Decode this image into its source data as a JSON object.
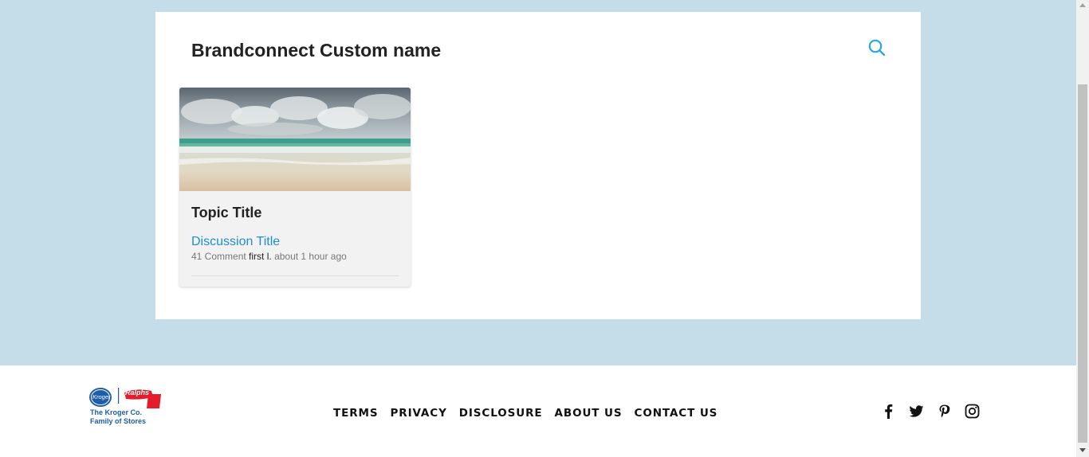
{
  "panel": {
    "title": "Brandconnect Custom name",
    "search_icon": "search-icon"
  },
  "card": {
    "image": "beach-photo",
    "topic_title": "Topic Title",
    "discussion_title": "Discussion Title",
    "comment_count": "41 Comment",
    "author": "first l.",
    "time": "about 1 hour ago"
  },
  "footer": {
    "logo_text_line1": "The Kroger Co.",
    "logo_text_line2": "Family of Stores",
    "logo_circle_text": "Kroger",
    "logo_ralphs_text": "Ralphs",
    "nav": [
      "TERMS",
      "PRIVACY",
      "DISCLOSURE",
      "ABOUT US",
      "CONTACT US"
    ],
    "social": [
      "facebook-icon",
      "twitter-icon",
      "pinterest-icon",
      "instagram-icon"
    ]
  },
  "colors": {
    "background": "#c5dce9",
    "link": "#1f8dd6",
    "search_icon": "#29a8e0",
    "brand_blue": "#1d5ea8"
  }
}
